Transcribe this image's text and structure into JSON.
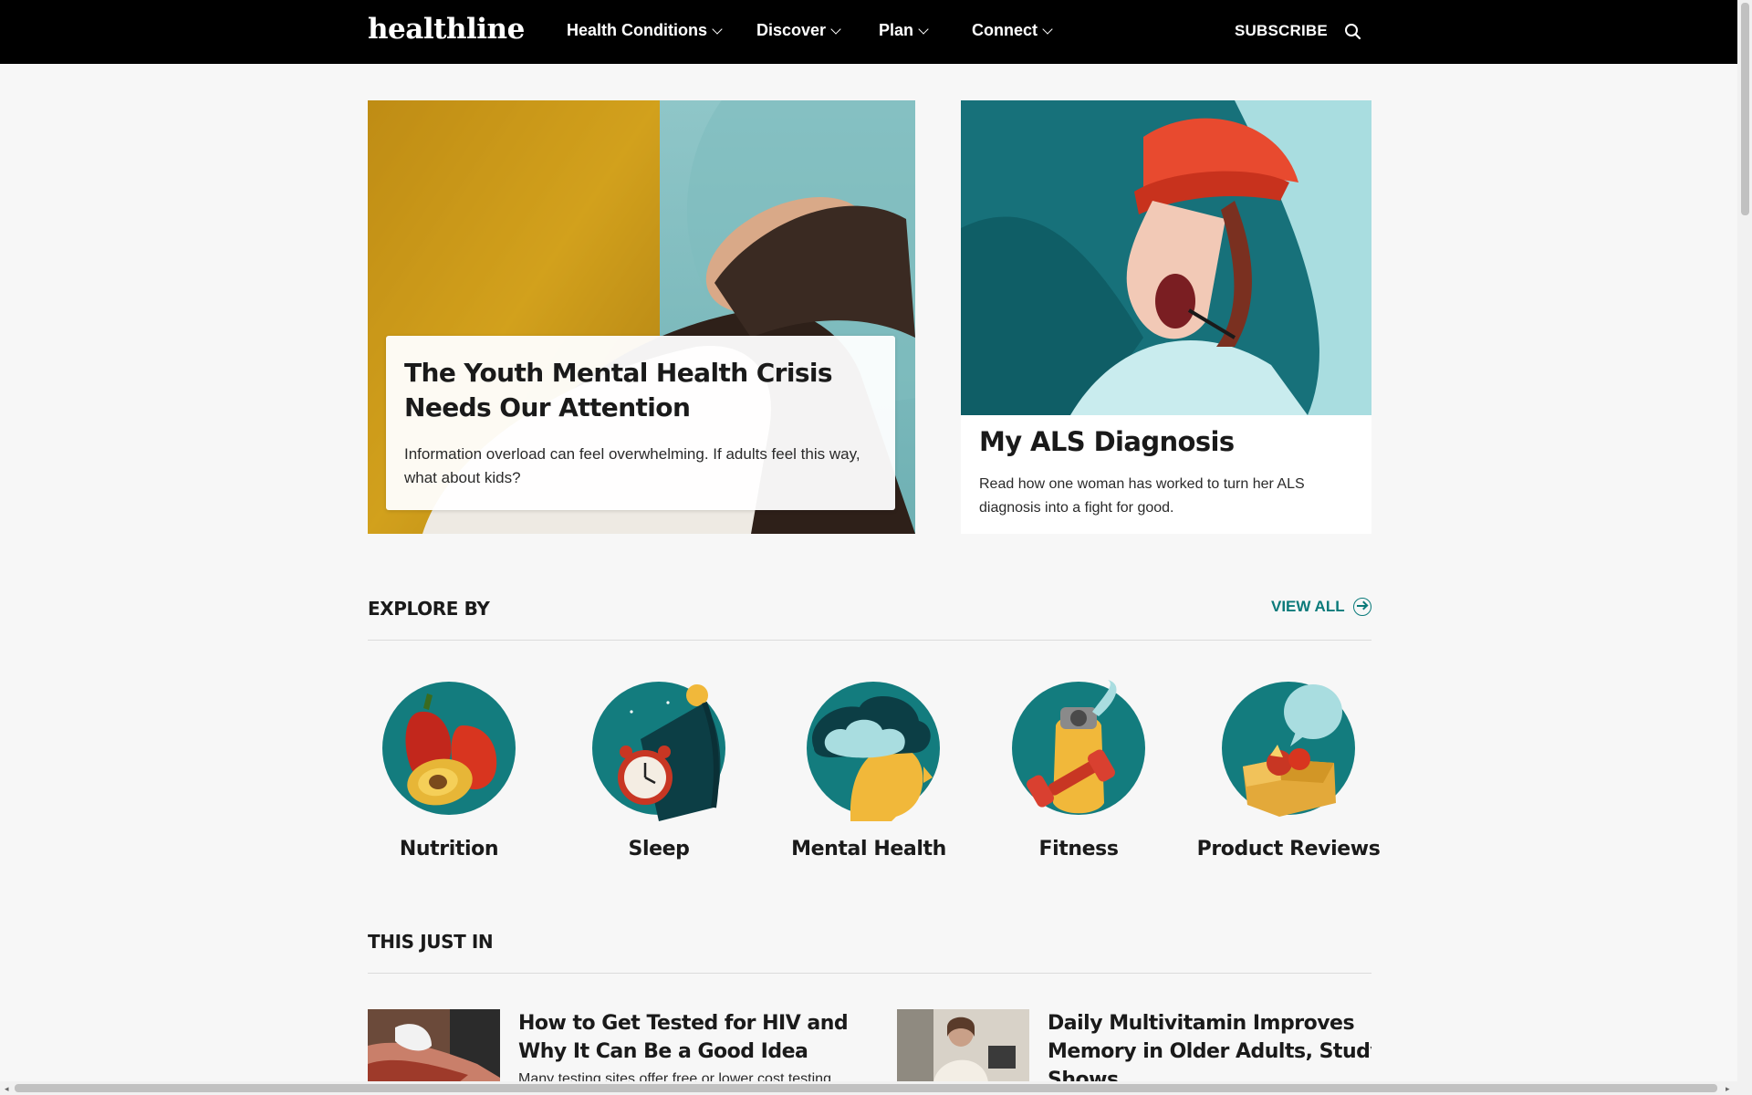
{
  "nav": {
    "logo": "healthline",
    "items": [
      {
        "label": "Health Conditions"
      },
      {
        "label": "Discover"
      },
      {
        "label": "Plan"
      },
      {
        "label": "Connect"
      }
    ],
    "subscribe": "SUBSCRIBE",
    "search_icon": "search-icon"
  },
  "hero": {
    "main": {
      "title": "The Youth Mental Health Crisis Needs Our Attention",
      "description": "Information overload can feel overwhelming. If adults feel this way, what about kids?"
    },
    "side": {
      "title": "My ALS Diagnosis",
      "description": "Read how one woman has worked to turn her ALS diagnosis into a fight for good."
    }
  },
  "explore": {
    "title": "EXPLORE BY",
    "view_all": "VIEW ALL",
    "categories": [
      {
        "label": "Nutrition",
        "icon": "nutrition-icon"
      },
      {
        "label": "Sleep",
        "icon": "sleep-icon"
      },
      {
        "label": "Mental Health",
        "icon": "mental-health-icon"
      },
      {
        "label": "Fitness",
        "icon": "fitness-icon"
      },
      {
        "label": "Product Reviews",
        "icon": "product-reviews-icon"
      }
    ]
  },
  "just_in": {
    "title": "THIS JUST IN",
    "articles": [
      {
        "title": "How to Get Tested for HIV and Why It Can Be a Good Idea",
        "description": "Many testing sites offer free or lower cost testing"
      },
      {
        "title": "Daily Multivitamin Improves Memory in Older Adults, Study Shows",
        "description": ""
      }
    ]
  },
  "colors": {
    "nav_bg": "#000000",
    "accent_teal": "#0a7a7a",
    "icon_teal": "#137c7e",
    "page_bg": "#f7f7f7"
  }
}
